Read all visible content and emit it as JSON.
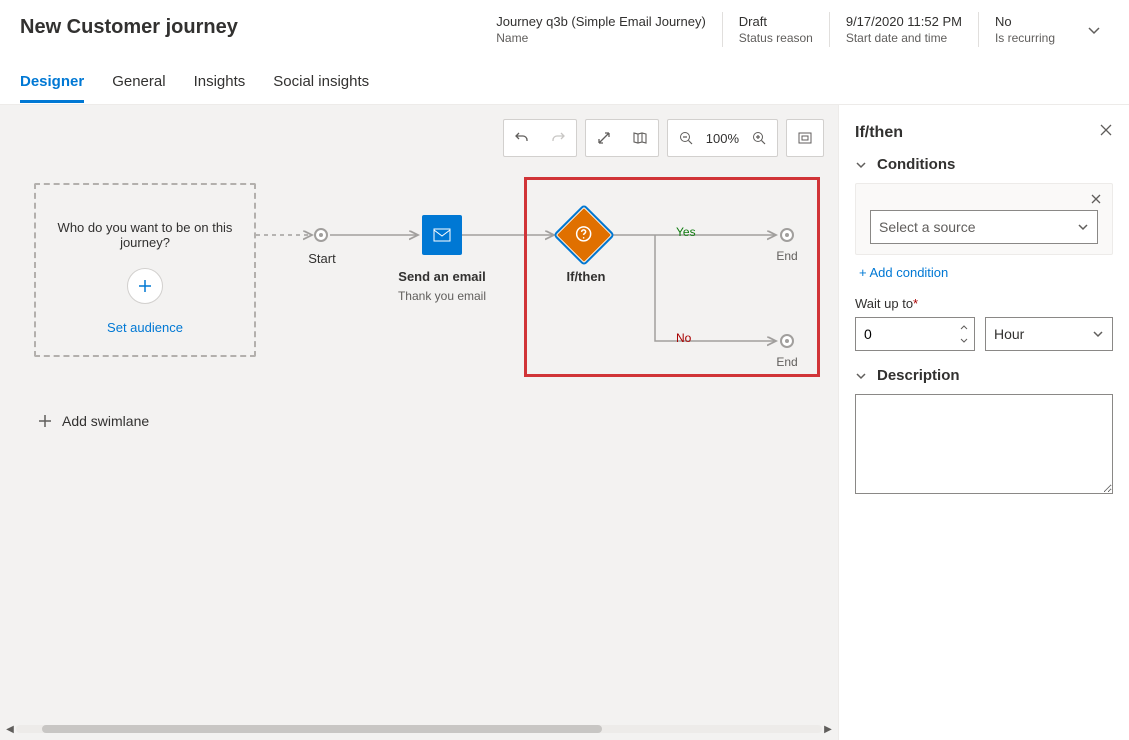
{
  "header": {
    "title": "New Customer journey",
    "fields": [
      {
        "value": "Journey q3b (Simple Email Journey)",
        "label": "Name"
      },
      {
        "value": "Draft",
        "label": "Status reason"
      },
      {
        "value": "9/17/2020 11:52 PM",
        "label": "Start date and time"
      },
      {
        "value": "No",
        "label": "Is recurring"
      }
    ]
  },
  "tabs": [
    "Designer",
    "General",
    "Insights",
    "Social insights"
  ],
  "active_tab": 0,
  "toolbar": {
    "zoom_label": "100%"
  },
  "canvas": {
    "audience_question": "Who do you want to be on this journey?",
    "set_audience": "Set audience",
    "start_label": "Start",
    "email_title": "Send an email",
    "email_subtitle": "Thank you email",
    "ifthen_label": "If/then",
    "yes_label": "Yes",
    "no_label": "No",
    "end_label": "End",
    "add_swimlane": "Add swimlane"
  },
  "panel": {
    "title": "If/then",
    "conditions_title": "Conditions",
    "source_placeholder": "Select a source",
    "add_condition": "+ Add condition",
    "wait_label": "Wait up to",
    "wait_value": "0",
    "wait_unit": "Hour",
    "description_title": "Description",
    "description_value": ""
  }
}
